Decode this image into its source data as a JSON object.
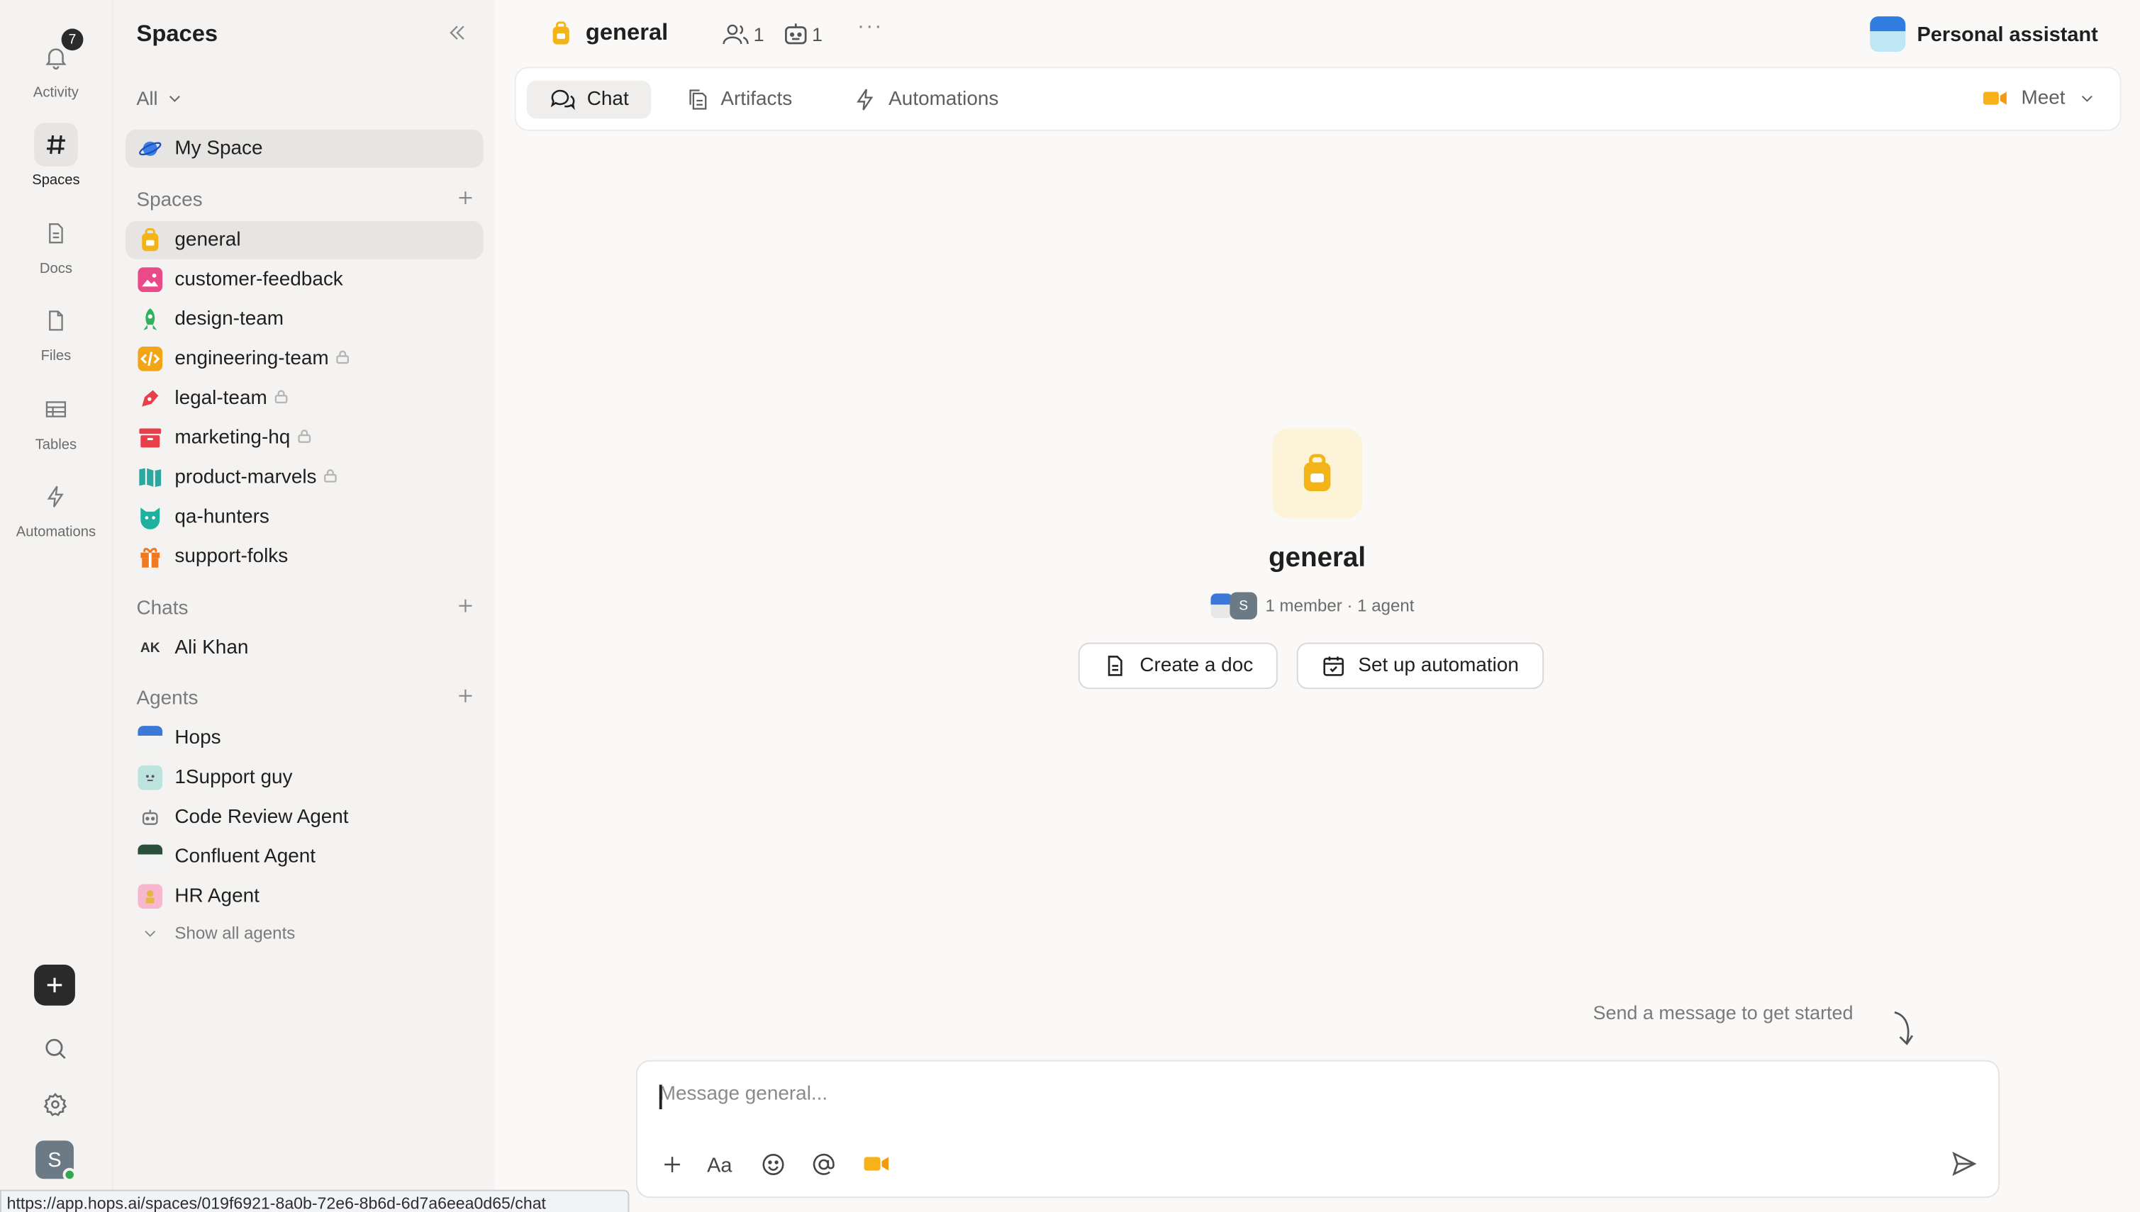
{
  "rail": {
    "activity_label": "Activity",
    "activity_badge": "7",
    "spaces_label": "Spaces",
    "docs_label": "Docs",
    "files_label": "Files",
    "tables_label": "Tables",
    "automations_label": "Automations",
    "user_initial": "S"
  },
  "sidebar": {
    "title": "Spaces",
    "filter": "All",
    "my_space": "My Space",
    "spaces_header": "Spaces",
    "spaces": [
      {
        "name": "general",
        "locked": false,
        "color": "#f2b417"
      },
      {
        "name": "customer-feedback",
        "locked": false,
        "color": "#e84a8a"
      },
      {
        "name": "design-team",
        "locked": false,
        "color": "#2fb35a"
      },
      {
        "name": "engineering-team",
        "locked": true,
        "color": "#f2a617"
      },
      {
        "name": "legal-team",
        "locked": true,
        "color": "#e8404a"
      },
      {
        "name": "marketing-hq",
        "locked": true,
        "color": "#e8404a"
      },
      {
        "name": "product-marvels",
        "locked": true,
        "color": "#2ba8a0"
      },
      {
        "name": "qa-hunters",
        "locked": false,
        "color": "#20b0a0"
      },
      {
        "name": "support-folks",
        "locked": false,
        "color": "#f07a24"
      }
    ],
    "chats_header": "Chats",
    "chats": [
      {
        "initials": "AK",
        "name": "Ali Khan"
      }
    ],
    "agents_header": "Agents",
    "agents": [
      {
        "name": "Hops"
      },
      {
        "name": "1Support guy"
      },
      {
        "name": "Code Review Agent"
      },
      {
        "name": "Confluent Agent"
      },
      {
        "name": "HR Agent"
      }
    ],
    "show_all": "Show all agents"
  },
  "status_url": "https://app.hops.ai/spaces/019f6921-8a0b-72e6-8b6d-6d7a6eea0d65/chat",
  "header": {
    "space_name": "general",
    "members_count": "1",
    "agents_count": "1",
    "more": "···",
    "assistant": "Personal assistant"
  },
  "tabs": {
    "chat": "Chat",
    "artifacts": "Artifacts",
    "automations": "Automations",
    "meet": "Meet"
  },
  "empty_state": {
    "title": "general",
    "member_avatar_initial": "S",
    "subtitle": "1 member · 1 agent",
    "create_doc": "Create a doc",
    "setup_automation": "Set up automation",
    "hint": "Send a message to get started"
  },
  "composer": {
    "placeholder": "Message general..."
  },
  "colors": {
    "accent_yellow": "#f2b417",
    "online": "#2fa84f"
  }
}
